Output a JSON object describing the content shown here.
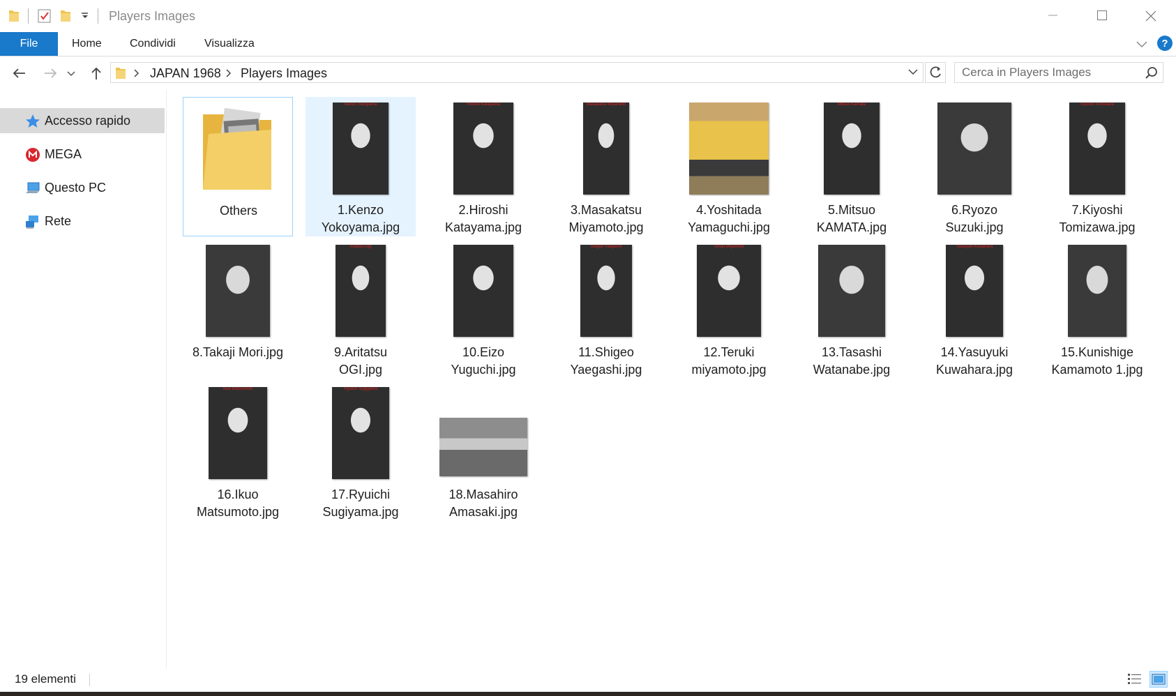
{
  "window": {
    "title": "Players Images"
  },
  "ribbon": {
    "tabs": [
      "File",
      "Home",
      "Condividi",
      "Visualizza"
    ]
  },
  "address": {
    "crumbs": [
      "JAPAN 1968",
      "Players Images"
    ]
  },
  "search": {
    "placeholder": "Cerca in Players Images"
  },
  "sidebar": {
    "items": [
      "Accesso rapido",
      "MEGA",
      "Questo PC",
      "Rete"
    ]
  },
  "files": [
    {
      "line1": "Others",
      "line2": "",
      "kind": "folder"
    },
    {
      "line1": "1.Kenzo",
      "line2": "Yokoyama.jpg",
      "caption": "Kenzo Yokoyama",
      "kind": "card"
    },
    {
      "line1": "2.Hiroshi",
      "line2": "Katayama.jpg",
      "caption": "Hiroshi Katayama",
      "kind": "card"
    },
    {
      "line1": "3.Masakatsu",
      "line2": "Miyamoto.jpg",
      "caption": "Masakatsu Miyamoto",
      "kind": "card"
    },
    {
      "line1": "4.Yoshitada",
      "line2": "Yamaguchi.jpg",
      "caption": "",
      "kind": "color"
    },
    {
      "line1": "5.Mitsuo",
      "line2": "KAMATA.jpg",
      "caption": "Mitsuo Kamata",
      "kind": "card"
    },
    {
      "line1": "6.Ryozo",
      "line2": "Suzuki.jpg",
      "caption": "",
      "kind": "photo"
    },
    {
      "line1": "7.Kiyoshi",
      "line2": "Tomizawa.jpg",
      "caption": "Kiyoshi Tomizawa",
      "kind": "card"
    },
    {
      "line1": "8.Takaji Mori.jpg",
      "line2": "",
      "caption": "",
      "kind": "photo"
    },
    {
      "line1": "9.Aritatsu",
      "line2": "OGI.jpg",
      "caption": "Aritatsu Ogi",
      "kind": "card"
    },
    {
      "line1": "10.Eizo",
      "line2": "Yuguchi.jpg",
      "caption": "",
      "kind": "card"
    },
    {
      "line1": "11.Shigeo",
      "line2": "Yaegashi.jpg",
      "caption": "Shigeo Yaegashi",
      "kind": "card"
    },
    {
      "line1": "12.Teruki",
      "line2": "miyamoto.jpg",
      "caption": "Teruki Miyamoto",
      "kind": "card"
    },
    {
      "line1": "13.Tasashi",
      "line2": "Watanabe.jpg",
      "caption": "",
      "kind": "photo"
    },
    {
      "line1": "14.Yasuyuki",
      "line2": "Kuwahara.jpg",
      "caption": "Yasuyuki Kuwahara",
      "kind": "card"
    },
    {
      "line1": "15.Kunishige",
      "line2": "Kamamoto 1.jpg",
      "caption": "",
      "kind": "photo"
    },
    {
      "line1": "16.Ikuo",
      "line2": "Matsumoto.jpg",
      "caption": "Ikuo Matsumoto",
      "kind": "card"
    },
    {
      "line1": "17.Ryuichi",
      "line2": "Sugiyama.jpg",
      "caption": "Ryuichi Sugiyama",
      "kind": "card"
    },
    {
      "line1": "18.Masahiro",
      "line2": "Amasaki.jpg",
      "caption": "",
      "kind": "landscape"
    }
  ],
  "status": {
    "count": "19 elementi"
  },
  "colors": {
    "accent": "#1979ca",
    "selection": "#e5f3ff",
    "folder": "#f4c95d"
  }
}
